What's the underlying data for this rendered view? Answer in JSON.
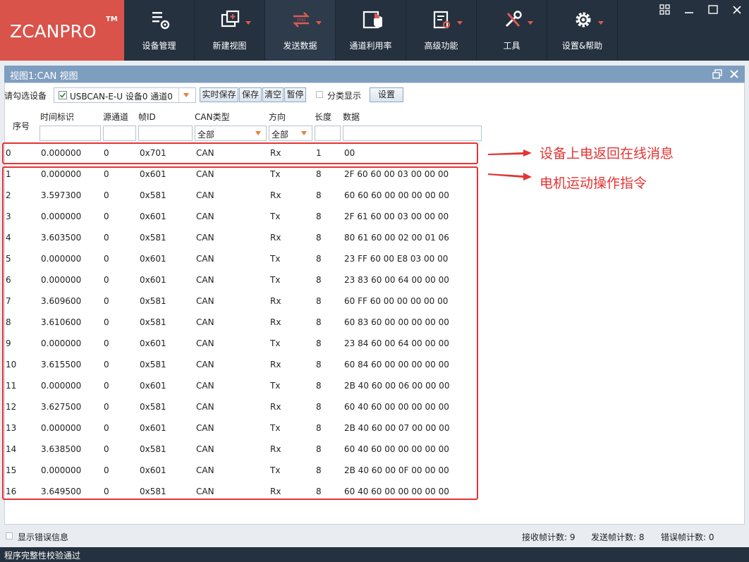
{
  "app": {
    "logo": "ZCANPRO",
    "logo_tm": "TM"
  },
  "toolbar": [
    {
      "label": "设备管理",
      "icon": "device-manage-icon",
      "caret": false
    },
    {
      "label": "新建视图",
      "icon": "new-view-icon",
      "caret": true
    },
    {
      "label": "发送数据",
      "icon": "send-data-icon",
      "caret": true
    },
    {
      "label": "通道利用率",
      "icon": "channel-usage-icon",
      "caret": false
    },
    {
      "label": "高级功能",
      "icon": "advanced-icon",
      "caret": true
    },
    {
      "label": "工具",
      "icon": "tools-icon",
      "caret": true
    },
    {
      "label": "设置&帮助",
      "icon": "settings-icon",
      "caret": true
    }
  ],
  "panel": {
    "title": "视图1:CAN 视图"
  },
  "devbar": {
    "label": "请勾选设备",
    "device": "USBCAN-E-U 设备0 通道0",
    "btn_realtime_save": "实时保存",
    "btn_save": "保存",
    "btn_clear": "清空",
    "btn_pause": "暂停",
    "category_label": "分类显示",
    "btn_settings": "设置"
  },
  "columns": {
    "seq": "序号",
    "time": "时间标识",
    "src": "源通道",
    "id": "帧ID",
    "type": "CAN类型",
    "dir": "方向",
    "len": "长度",
    "data": "数据"
  },
  "filters": {
    "type": "全部",
    "dir": "全部"
  },
  "rows": [
    {
      "seq": "0",
      "time": "0.000000",
      "src": "0",
      "id": "0x701",
      "type": "CAN",
      "dir": "Rx",
      "len": "1",
      "data": "00"
    },
    {
      "seq": "1",
      "time": "0.000000",
      "src": "0",
      "id": "0x601",
      "type": "CAN",
      "dir": "Tx",
      "len": "8",
      "data": "2F 60 60 00 03 00 00 00"
    },
    {
      "seq": "2",
      "time": "3.597300",
      "src": "0",
      "id": "0x581",
      "type": "CAN",
      "dir": "Rx",
      "len": "8",
      "data": "60 60 60 00 00 00 00 00"
    },
    {
      "seq": "3",
      "time": "0.000000",
      "src": "0",
      "id": "0x601",
      "type": "CAN",
      "dir": "Tx",
      "len": "8",
      "data": "2F 61 60 00 03 00 00 00"
    },
    {
      "seq": "4",
      "time": "3.603500",
      "src": "0",
      "id": "0x581",
      "type": "CAN",
      "dir": "Rx",
      "len": "8",
      "data": "80 61 60 00 02 00 01 06"
    },
    {
      "seq": "5",
      "time": "0.000000",
      "src": "0",
      "id": "0x601",
      "type": "CAN",
      "dir": "Tx",
      "len": "8",
      "data": "23 FF 60 00 E8 03 00 00"
    },
    {
      "seq": "6",
      "time": "0.000000",
      "src": "0",
      "id": "0x601",
      "type": "CAN",
      "dir": "Tx",
      "len": "8",
      "data": "23 83 60 00 64 00 00 00"
    },
    {
      "seq": "7",
      "time": "3.609600",
      "src": "0",
      "id": "0x581",
      "type": "CAN",
      "dir": "Rx",
      "len": "8",
      "data": "60 FF 60 00 00 00 00 00"
    },
    {
      "seq": "8",
      "time": "3.610600",
      "src": "0",
      "id": "0x581",
      "type": "CAN",
      "dir": "Rx",
      "len": "8",
      "data": "60 83 60 00 00 00 00 00"
    },
    {
      "seq": "9",
      "time": "0.000000",
      "src": "0",
      "id": "0x601",
      "type": "CAN",
      "dir": "Tx",
      "len": "8",
      "data": "23 84 60 00 64 00 00 00"
    },
    {
      "seq": "10",
      "time": "3.615500",
      "src": "0",
      "id": "0x581",
      "type": "CAN",
      "dir": "Rx",
      "len": "8",
      "data": "60 84 60 00 00 00 00 00"
    },
    {
      "seq": "11",
      "time": "0.000000",
      "src": "0",
      "id": "0x601",
      "type": "CAN",
      "dir": "Tx",
      "len": "8",
      "data": "2B 40 60 00 06 00 00 00"
    },
    {
      "seq": "12",
      "time": "3.627500",
      "src": "0",
      "id": "0x581",
      "type": "CAN",
      "dir": "Rx",
      "len": "8",
      "data": "60 40 60 00 00 00 00 00"
    },
    {
      "seq": "13",
      "time": "0.000000",
      "src": "0",
      "id": "0x601",
      "type": "CAN",
      "dir": "Tx",
      "len": "8",
      "data": "2B 40 60 00 07 00 00 00"
    },
    {
      "seq": "14",
      "time": "3.638500",
      "src": "0",
      "id": "0x581",
      "type": "CAN",
      "dir": "Rx",
      "len": "8",
      "data": "60 40 60 00 00 00 00 00"
    },
    {
      "seq": "15",
      "time": "0.000000",
      "src": "0",
      "id": "0x601",
      "type": "CAN",
      "dir": "Tx",
      "len": "8",
      "data": "2B 40 60 00 0F 00 00 00"
    },
    {
      "seq": "16",
      "time": "3.649500",
      "src": "0",
      "id": "0x581",
      "type": "CAN",
      "dir": "Rx",
      "len": "8",
      "data": "60 40 60 00 00 00 00 00"
    }
  ],
  "annotations": {
    "online_msg": "设备上电返回在线消息",
    "motor_cmd": "电机运动操作指令"
  },
  "status": {
    "show_errors": "显示错误信息",
    "rx_count": "接收帧计数: 9",
    "tx_count": "发送帧计数: 8",
    "err_count": "错误帧计数: 0"
  },
  "bottom": {
    "message": "程序完整性校验通过"
  },
  "colors": {
    "topbar": "#25313f",
    "logo_bg": "#d9534b",
    "panel_title": "#7e9ec0",
    "annotation_red": "#e53333",
    "dropdown_arrow": "#e67e3a"
  }
}
